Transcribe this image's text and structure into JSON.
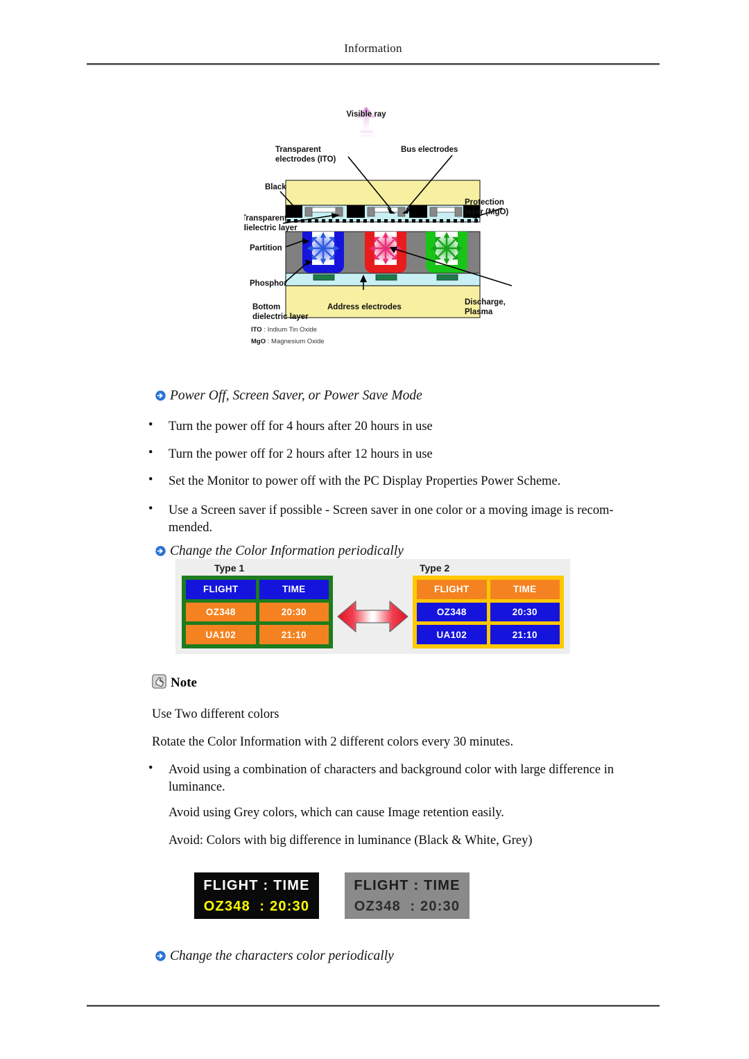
{
  "header": {
    "title": "Information"
  },
  "figure_pdp": {
    "labels": {
      "visible_ray": "Visible ray",
      "transparent_electrodes_l1": "Transparent",
      "transparent_electrodes_l2": "electrodes  (ITO)",
      "bus_electrodes": "Bus electrodes",
      "black": "Black",
      "protection_l1": "Protection",
      "protection_l2": "layer (MgO)",
      "transparent_dielectric_l1": "Transparent",
      "transparent_dielectric_l2": "dielectric layer",
      "partition": "Partition",
      "phosphor": "Phosphor",
      "bottom_dielectric_l1": "Bottom",
      "bottom_dielectric_l2": "dielectric layer",
      "address_electrodes": "Address electrodes",
      "discharge_l1": "Discharge,",
      "discharge_l2": "Plasma"
    },
    "legend": [
      {
        "abbr": "ITO",
        "sep": " : ",
        "text": "Indium Tin Oxide"
      },
      {
        "abbr": "MgO",
        "sep": " : ",
        "text": "Magnesium Oxide"
      }
    ]
  },
  "section_power": {
    "heading": "Power Off, Screen Saver, or Power Save Mode",
    "bullet_char": "•",
    "items": [
      "Turn the power off for 4 hours after 20 hours in use",
      "Turn the power off for 2 hours after 12 hours in use",
      "Set the Monitor to power off with the PC Display Properties Power Scheme.",
      "Use a Screen saver if possible - Screen saver in one color or a moving image is recom-\nmended."
    ]
  },
  "section_color": {
    "heading": "Change the Color Information periodically",
    "type1": {
      "label": "Type 1",
      "border_color": "#1e7b1e",
      "header_bg": "#1414dc",
      "row_bg": "#f58220",
      "cells": [
        [
          "FLIGHT",
          "TIME"
        ],
        [
          "OZ348",
          "20:30"
        ],
        [
          "UA102",
          "21:10"
        ]
      ]
    },
    "type2": {
      "label": "Type 2",
      "border_color": "#ffc800",
      "header_bg": "#f58220",
      "row_bg": "#1414dc",
      "cells": [
        [
          "FLIGHT",
          "TIME"
        ],
        [
          "OZ348",
          "20:30"
        ],
        [
          "UA102",
          "21:10"
        ]
      ]
    },
    "swap_icon": "double-arrow-horizontal"
  },
  "note": {
    "icon": "note-hand-icon",
    "label": "Note",
    "lines": [
      "Use Two different colors",
      "Rotate the Color Information with 2 different colors every 30 minutes."
    ],
    "bullet_char": "•",
    "bullet_item": "Avoid using a combination of characters and background color with large difference in\nluminance.",
    "extra_lines": [
      "Avoid using Grey colors, which can cause Image retention easily.",
      "Avoid: Colors with big difference in luminance (Black & White, Grey)"
    ]
  },
  "boards": {
    "dark": {
      "bg": "#0a0a0a",
      "line1": {
        "text": "FLIGHT : TIME",
        "color": "#ffffff"
      },
      "line2": {
        "text": "OZ348  : 20:30",
        "color": "#ffff00"
      }
    },
    "grey": {
      "bg": "#8a8a8a",
      "line1": {
        "text": "FLIGHT : TIME",
        "color": "#1c1c1c"
      },
      "line2": {
        "text": "OZ348  : 20:30",
        "color": "#2b2b2b"
      }
    }
  },
  "section_characters": {
    "heading": "Change the characters color periodically"
  }
}
